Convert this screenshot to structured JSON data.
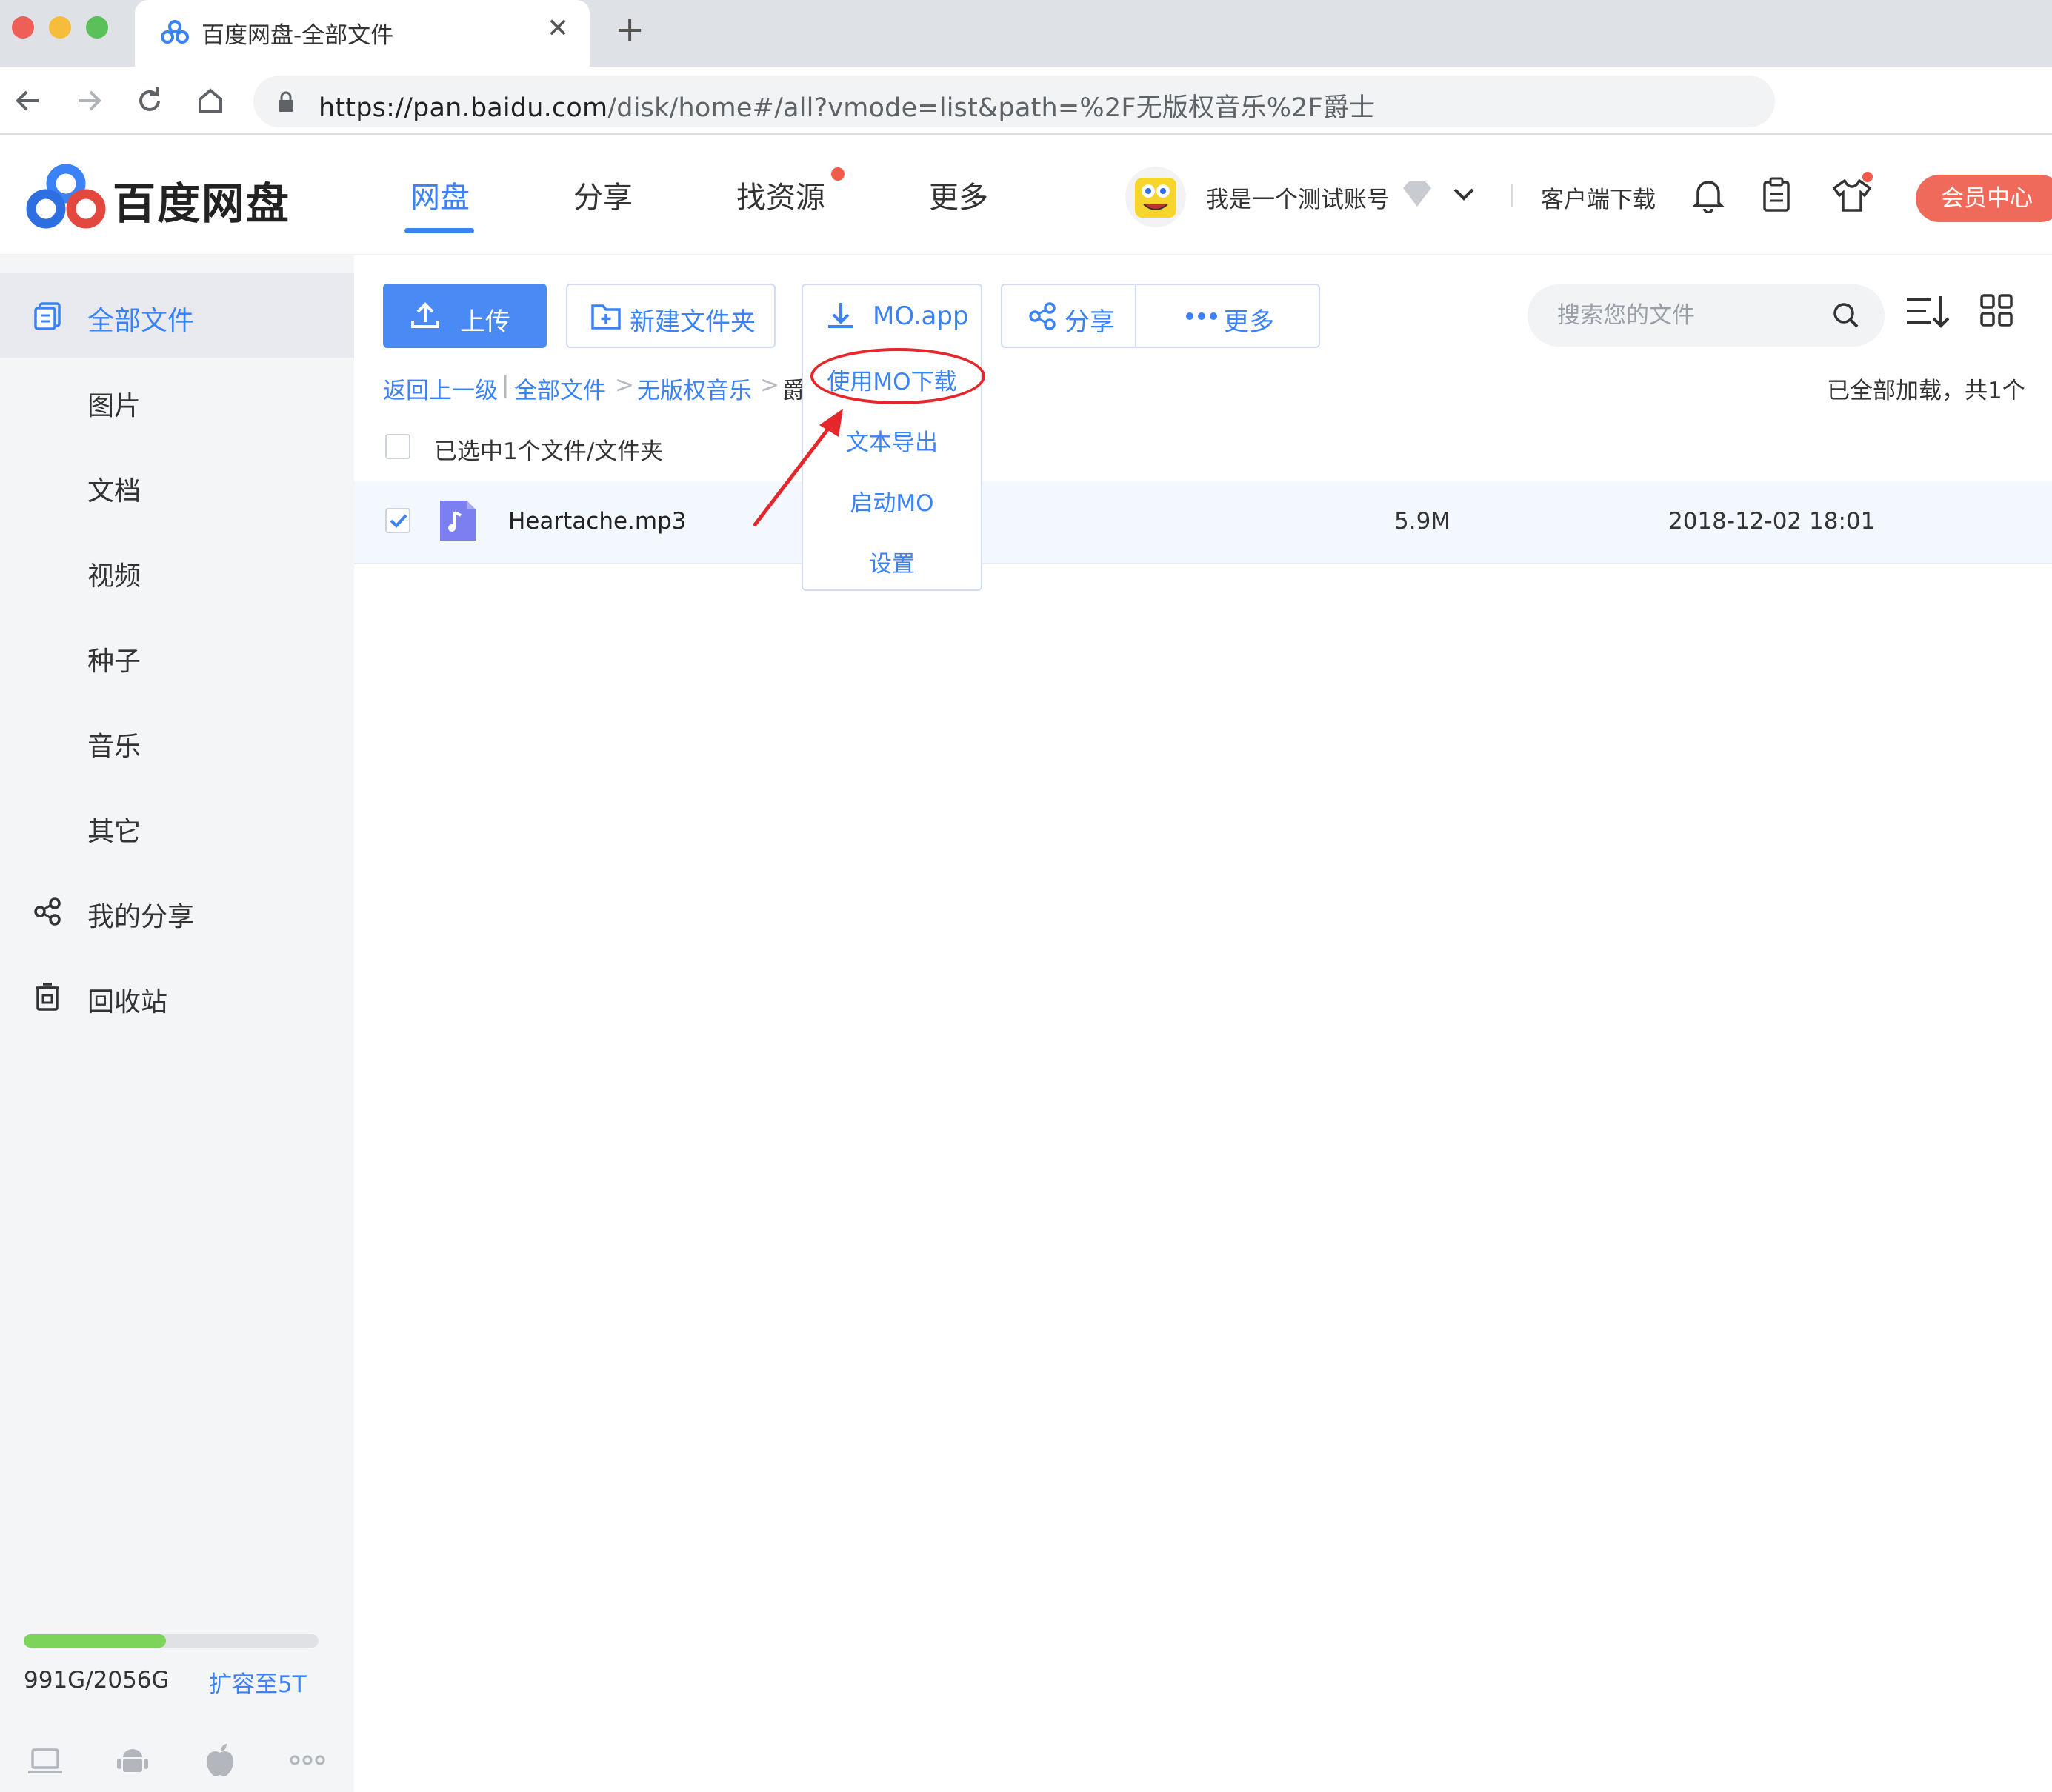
{
  "browser": {
    "tab_title": "百度网盘-全部文件",
    "url_host": "https://pan.baidu.com",
    "url_path": "/disk/home#/all?vmode=list&path=%2F无版权音乐%2F爵士",
    "traffic_colors": [
      "#ee5f58",
      "#f6bd3b",
      "#5ac05a"
    ]
  },
  "header": {
    "logo_text": "百度网盘",
    "nav": [
      "网盘",
      "分享",
      "找资源",
      "更多"
    ],
    "active_nav": "网盘",
    "username": "我是一个测试账号",
    "client_download": "客户端下载",
    "vip_button": "会员中心",
    "accent_color": "#3b82f6"
  },
  "sidebar": {
    "items": [
      {
        "label": "全部文件",
        "icon": "all-files-icon",
        "active": true
      },
      {
        "label": "图片"
      },
      {
        "label": "文档"
      },
      {
        "label": "视频"
      },
      {
        "label": "种子"
      },
      {
        "label": "音乐"
      },
      {
        "label": "其它"
      },
      {
        "label": "我的分享",
        "icon": "share-icon"
      },
      {
        "label": "回收站",
        "icon": "recycle-bin-icon"
      }
    ],
    "quota_text": "991G/2056G",
    "quota_fraction": 0.482,
    "expand_link": "扩容至5T"
  },
  "toolbar": {
    "upload": "上传",
    "new_folder": "新建文件夹",
    "download": "MO.app",
    "share": "分享",
    "more": "更多",
    "search_placeholder": "搜索您的文件"
  },
  "breadcrumb": {
    "back": "返回上一级",
    "items": [
      "全部文件",
      "无版权音乐",
      "爵"
    ],
    "loaded_text": "已全部加载，共1个"
  },
  "selection_text": "已选中1个文件/文件夹",
  "files": [
    {
      "name": "Heartache.mp3",
      "size": "5.9M",
      "date": "2018-12-02 18:01",
      "checked": true
    }
  ],
  "dropdown": {
    "items": [
      "使用MO下载",
      "文本导出",
      "启动MO",
      "设置"
    ],
    "highlighted": "使用MO下载"
  }
}
